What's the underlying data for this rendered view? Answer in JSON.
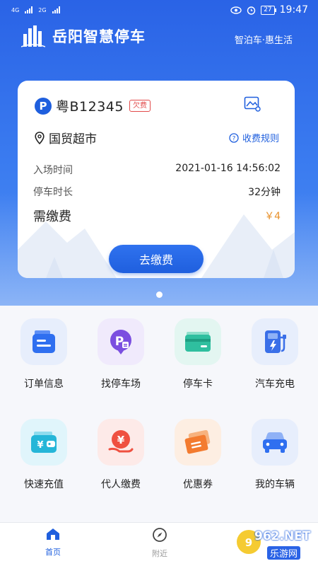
{
  "status_bar": {
    "sim1": "4G",
    "sim2": "2G",
    "battery": "27",
    "time": "19:47"
  },
  "header": {
    "app_title": "岳阳智慧停车",
    "slogan": "智泊车·惠生活"
  },
  "parking_card": {
    "plate": "粤B12345",
    "arrears_badge": "欠费",
    "location": "国贸超市",
    "fee_rules": "收费规则",
    "entry_time_label": "入场时间",
    "entry_time_value": "2021-01-16 14:56:02",
    "duration_label": "停车时长",
    "duration_value": "32分钟",
    "fee_due_label": "需缴费",
    "fee_due_value": "￥4",
    "pay_button": "去缴费"
  },
  "carousel": {
    "active_index": 0,
    "count": 1
  },
  "services": [
    {
      "label": "订单信息",
      "icon": "order-info-icon",
      "color": "#2f6ff0"
    },
    {
      "label": "找停车场",
      "icon": "find-parking-icon",
      "color": "#7b4fe0"
    },
    {
      "label": "停车卡",
      "icon": "parking-card-icon",
      "color": "#2fbf9f"
    },
    {
      "label": "汽车充电",
      "icon": "car-charging-icon",
      "color": "#3a6fe8"
    },
    {
      "label": "快速充值",
      "icon": "quick-recharge-icon",
      "color": "#25b6d8"
    },
    {
      "label": "代人缴费",
      "icon": "pay-for-others-icon",
      "color": "#ef5040"
    },
    {
      "label": "优惠券",
      "icon": "coupon-icon",
      "color": "#f37b2f"
    },
    {
      "label": "我的车辆",
      "icon": "my-vehicle-icon",
      "color": "#2f6ff0"
    }
  ],
  "tabbar": {
    "home": "首页",
    "nearby": "附近"
  },
  "watermark": {
    "brand": "962.NET",
    "sub": "乐游网"
  }
}
